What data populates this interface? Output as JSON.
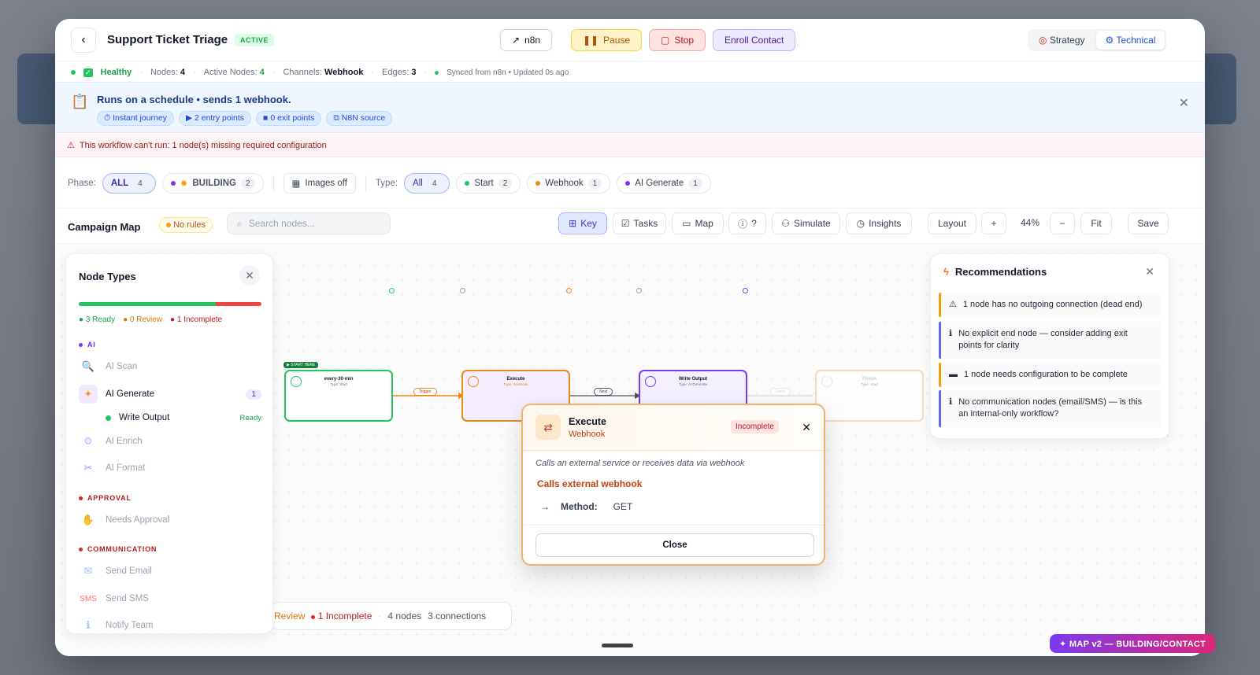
{
  "header": {
    "title": "Support Ticket Triage",
    "status_badge": "ACTIVE",
    "buttons": {
      "n8n": "n8n",
      "pause": "Pause",
      "stop": "Stop",
      "enroll": "Enroll Contact"
    },
    "view_toggle": {
      "strategy": "Strategy",
      "technical": "Technical",
      "selected": "Technical"
    }
  },
  "status_bar": {
    "health": "Healthy",
    "nodes_label": "Nodes:",
    "nodes": "4",
    "active_nodes_label": "Active Nodes:",
    "active_nodes": "4",
    "channels_label": "Channels:",
    "channels": "Webhook",
    "edges_label": "Edges:",
    "edges": "3",
    "sync": "Synced from n8n • Updated 0s ago"
  },
  "info_banner": {
    "headline": "Runs on a schedule • sends 1 webhook.",
    "chips": [
      "Instant journey",
      "2 entry points",
      "0 exit points",
      "N8N source"
    ]
  },
  "warning": "This workflow can't run: 1 node(s) missing required configuration",
  "filters": {
    "phase_label": "Phase:",
    "phase": [
      {
        "label": "ALL",
        "count": "4",
        "active": true
      },
      {
        "label": "BUILDING",
        "count": "2",
        "active": false
      }
    ],
    "images": "Images off",
    "type_label": "Type:",
    "types": [
      {
        "label": "All",
        "count": "4",
        "active": true,
        "color": ""
      },
      {
        "label": "Start",
        "count": "2",
        "active": false,
        "color": "#22c55e"
      },
      {
        "label": "Webhook",
        "count": "1",
        "active": false,
        "color": "#ea8a1c"
      },
      {
        "label": "AI Generate",
        "count": "1",
        "active": false,
        "color": "#7c3aed"
      }
    ]
  },
  "toolbar": {
    "title": "Campaign Map",
    "no_rules": "No rules",
    "search_placeholder": "Search nodes...",
    "key": "Key",
    "tasks": "Tasks",
    "map": "Map",
    "help": "?",
    "simulate": "Simulate",
    "insights": "Insights",
    "layout": "Layout",
    "zoom_in": "+",
    "zoom": "44%",
    "zoom_out": "−",
    "fit": "Fit",
    "save": "Save"
  },
  "node_types_panel": {
    "title": "Node Types",
    "progress_ready_fraction": 0.75,
    "legend": {
      "ready": "3 Ready",
      "review": "0 Review",
      "incomplete": "1 Incomplete"
    },
    "categories": {
      "ai": "AI",
      "approval": "APPROVAL",
      "communication": "COMMUNICATION"
    },
    "items": {
      "ai_scan": "AI Scan",
      "ai_generate": "AI Generate",
      "ai_generate_count": "1",
      "write_output": "Write Output",
      "write_output_status": "Ready",
      "ai_enrich": "AI Enrich",
      "ai_format": "AI Format",
      "needs_approval": "Needs Approval",
      "send_email": "Send Email",
      "send_sms": "Send SMS",
      "sms_icon_text": "SMS",
      "notify_team": "Notify Team"
    }
  },
  "recommendations": {
    "title": "Recommendations",
    "items": [
      {
        "text": "1 node has no outgoing connection (dead end)",
        "icon": "⚠",
        "color": "#f59e0b"
      },
      {
        "text": "No explicit end node — consider adding exit points for clarity",
        "icon": "ℹ",
        "color": "#6366f1"
      },
      {
        "text": "1 node needs configuration to be complete",
        "icon": "▬",
        "color": "#f59e0b"
      },
      {
        "text": "No communication nodes (email/SMS) — is this an internal-only workflow?",
        "icon": "ℹ",
        "color": "#6366f1"
      }
    ]
  },
  "flow": {
    "start_tag": "▶ START HERE",
    "nodes": [
      {
        "name": "every-30-min",
        "type": "Type: Start"
      },
      {
        "name": "Execute",
        "type": "Type: Webhook"
      },
      {
        "name": "Write Output",
        "type": "Type: AI Generate"
      },
      {
        "name": "Finish",
        "type": "Type: Start"
      }
    ],
    "edge_labels": [
      "Trigger",
      "Next",
      "Done"
    ]
  },
  "popup": {
    "name": "Execute",
    "type": "Webhook",
    "status": "Incomplete",
    "description": "Calls an external service or receives data via webhook",
    "headline": "Calls external webhook",
    "method_label": "Method:",
    "method": "GET",
    "close": "Close"
  },
  "footer_summary": {
    "review": "0 Review",
    "incomplete": "1 Incomplete",
    "nodes": "4 nodes",
    "connections": "3 connections"
  },
  "corner_badge": "✦ MAP v2 — BUILDING/CONTACT"
}
